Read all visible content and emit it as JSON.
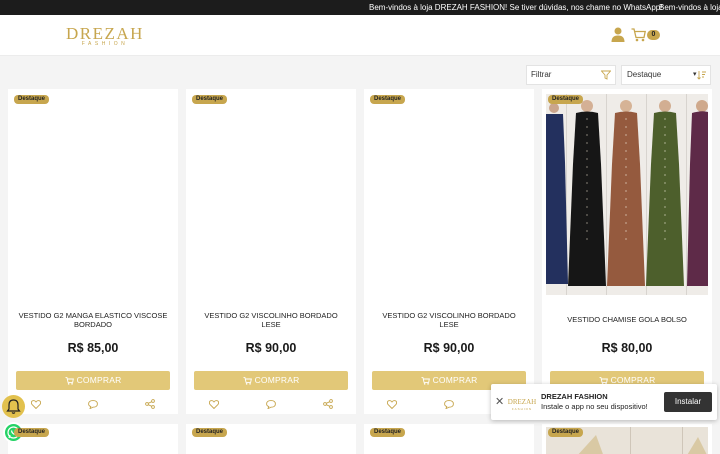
{
  "topbar": {
    "message": "Bem-vindos à loja DREZAH FASHION! Se tiver dúvidas, nos chame no WhatsApp!",
    "message_repeat": "Bem-vindos à loja"
  },
  "header": {
    "logo_main": "DREZAH",
    "logo_sub": "FASHION",
    "cart_count": "0"
  },
  "controls": {
    "filter_label": "Filtrar",
    "sort_selected": "Destaque"
  },
  "products": [
    {
      "badge": "Destaque",
      "name": "VESTIDO G2 MANGA ELASTICO VISCOSE BORDADO",
      "price": "R$ 85,00",
      "buy": "COMPRAR"
    },
    {
      "badge": "Destaque",
      "name": "VESTIDO G2 VISCOLINHO BORDADO LESE",
      "price": "R$ 90,00",
      "buy": "COMPRAR"
    },
    {
      "badge": "Destaque",
      "name": "VESTIDO G2 VISCOLINHO BORDADO LESE",
      "price": "R$ 90,00",
      "buy": "COMPRAR"
    },
    {
      "badge": "Destaque",
      "name": "VESTIDO CHAMISE GOLA BOLSO",
      "price": "R$ 80,00",
      "buy": "COMPRAR"
    }
  ],
  "next_row_badges": [
    "Destaque",
    "Destaque",
    "Destaque",
    "Destaque"
  ],
  "install_prompt": {
    "app_name": "DREZAH FASHION",
    "message": "Instale o app no seu dispositivo!",
    "button": "Instalar",
    "logo_main": "DREZAH",
    "logo_sub": "FASHION"
  },
  "colors": {
    "accent": "#c7a64e",
    "buy_button": "#e2c878",
    "topbar": "#1c1c1c",
    "whatsapp": "#25d366"
  }
}
